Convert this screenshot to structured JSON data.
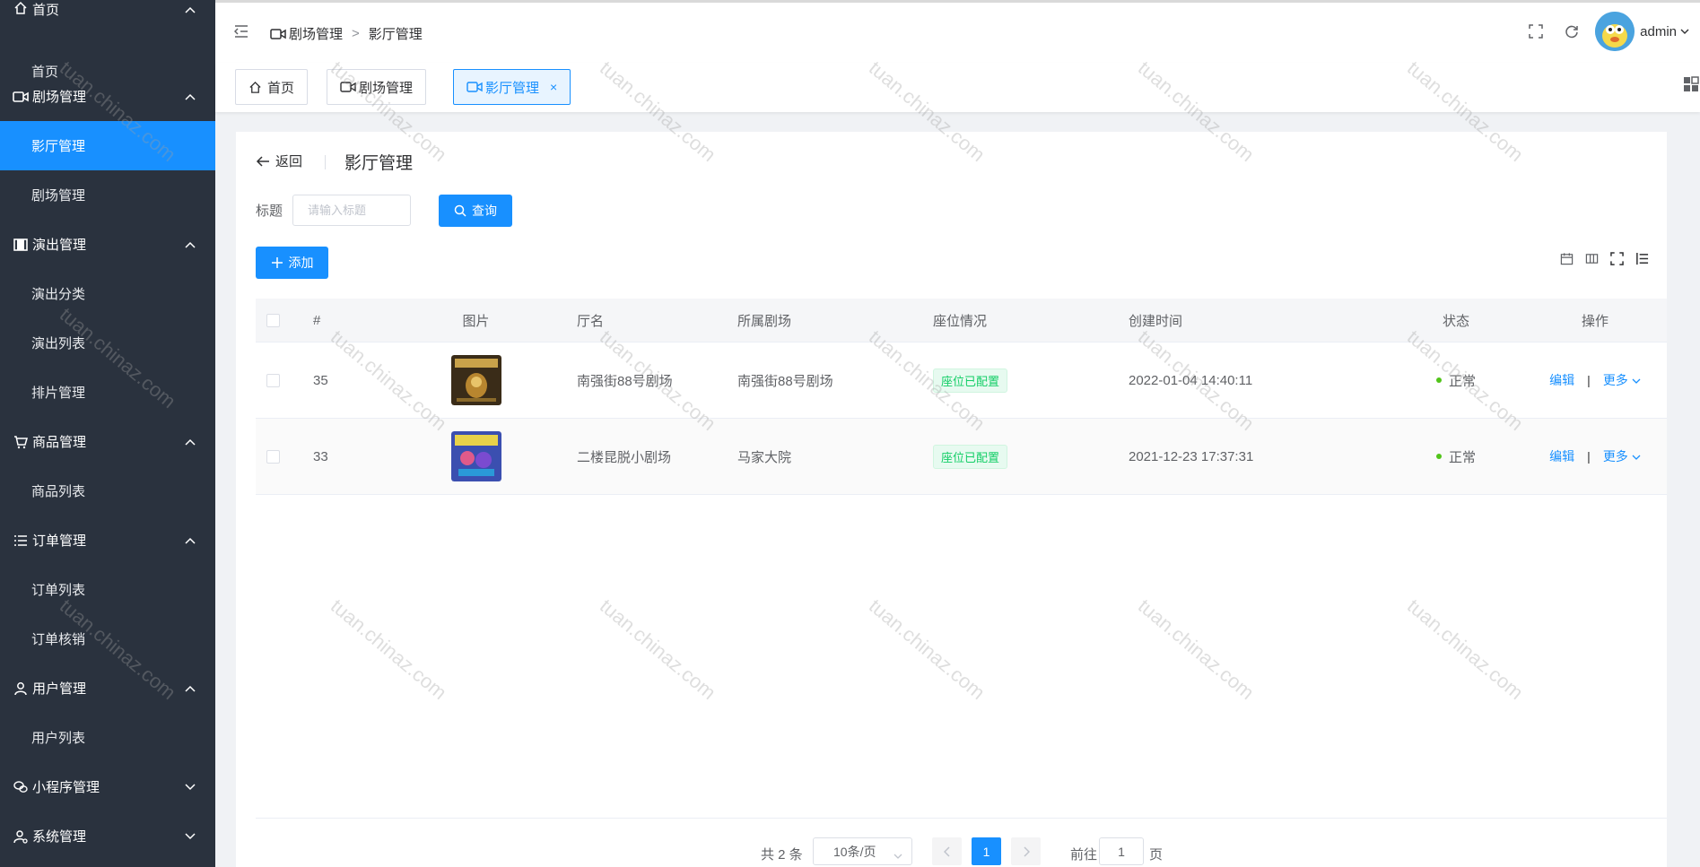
{
  "sidebar": {
    "groups": [
      {
        "label": "首页",
        "icon": "home-icon",
        "expanded": true,
        "items": [
          "首页"
        ]
      },
      {
        "label": "剧场管理",
        "icon": "video-camera-icon",
        "expanded": true,
        "items": [
          "影厅管理",
          "剧场管理"
        ]
      },
      {
        "label": "演出管理",
        "icon": "film-icon",
        "expanded": true,
        "items": [
          "演出分类",
          "演出列表",
          "排片管理"
        ]
      },
      {
        "label": "商品管理",
        "icon": "cart-icon",
        "expanded": true,
        "items": [
          "商品列表"
        ]
      },
      {
        "label": "订单管理",
        "icon": "list-icon",
        "expanded": true,
        "items": [
          "订单列表",
          "订单核销"
        ]
      },
      {
        "label": "用户管理",
        "icon": "user-icon",
        "expanded": true,
        "items": [
          "用户列表"
        ]
      },
      {
        "label": "小程序管理",
        "icon": "wechat-icon",
        "expanded": false,
        "items": []
      },
      {
        "label": "系统管理",
        "icon": "user-settings-icon",
        "expanded": false,
        "items": []
      }
    ],
    "active_item": "影厅管理",
    "active_color": "#1890ff",
    "bg_color": "#2a323e"
  },
  "header": {
    "breadcrumb": [
      "剧场管理",
      "影厅管理"
    ],
    "breadcrumb_sep": ">",
    "username": "admin"
  },
  "tags": [
    {
      "label": "首页",
      "icon": "home-icon",
      "active": false
    },
    {
      "label": "剧场管理",
      "icon": "video-camera-icon",
      "active": false
    },
    {
      "label": "影厅管理",
      "icon": "video-camera-icon",
      "active": true,
      "close": "×"
    }
  ],
  "page": {
    "back_label": "返回",
    "title": "影厅管理",
    "filter_label": "标题",
    "filter_placeholder": "请输入标题",
    "search_label": "查询",
    "add_label": "添加"
  },
  "table": {
    "columns": [
      "#",
      "图片",
      "厅名",
      "所属剧场",
      "座位情况",
      "创建时间",
      "状态",
      "操作"
    ],
    "rows": [
      {
        "id": "35",
        "name": "南强街88号剧场",
        "theater": "南强街88号剧场",
        "seat": "座位已配置",
        "created": "2022-01-04 14:40:11",
        "status": "正常",
        "edit": "编辑",
        "more": "更多"
      },
      {
        "id": "33",
        "name": "二楼昆脱小剧场",
        "theater": "马家大院",
        "seat": "座位已配置",
        "created": "2021-12-23 17:37:31",
        "status": "正常",
        "edit": "编辑",
        "more": "更多"
      }
    ],
    "status_color": "#52c41a"
  },
  "pagination": {
    "total_text": "共 2 条",
    "page_size": "10条/页",
    "current_page": "1",
    "goto_label": "前往",
    "goto_value": "1",
    "page_unit": "页"
  },
  "watermark": "tuan.chinaz.com"
}
